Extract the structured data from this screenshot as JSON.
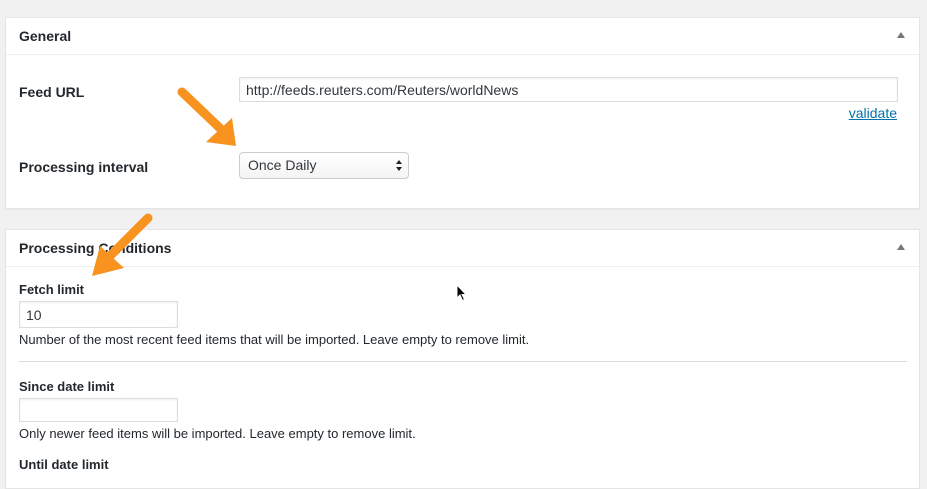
{
  "general": {
    "title": "General",
    "feed_url": {
      "label": "Feed URL",
      "value": "http://feeds.reuters.com/Reuters/worldNews",
      "validate_link": "validate"
    },
    "processing_interval": {
      "label": "Processing interval",
      "selected": "Once Daily"
    }
  },
  "conditions": {
    "title": "Processing Conditions",
    "fetch_limit": {
      "label": "Fetch limit",
      "value": "10",
      "description": "Number of the most recent feed items that will be imported. Leave empty to remove limit."
    },
    "since_date_limit": {
      "label": "Since date limit",
      "value": "",
      "description": "Only newer feed items will be imported. Leave empty to remove limit."
    },
    "until_date_limit": {
      "label": "Until date limit"
    }
  },
  "colors": {
    "annotation_arrow": "#f7931e",
    "link": "#0073aa"
  },
  "icons": [
    "collapse-toggle-icon",
    "select-arrows-icon",
    "mouse-cursor-icon",
    "annotation-arrow-icon"
  ]
}
